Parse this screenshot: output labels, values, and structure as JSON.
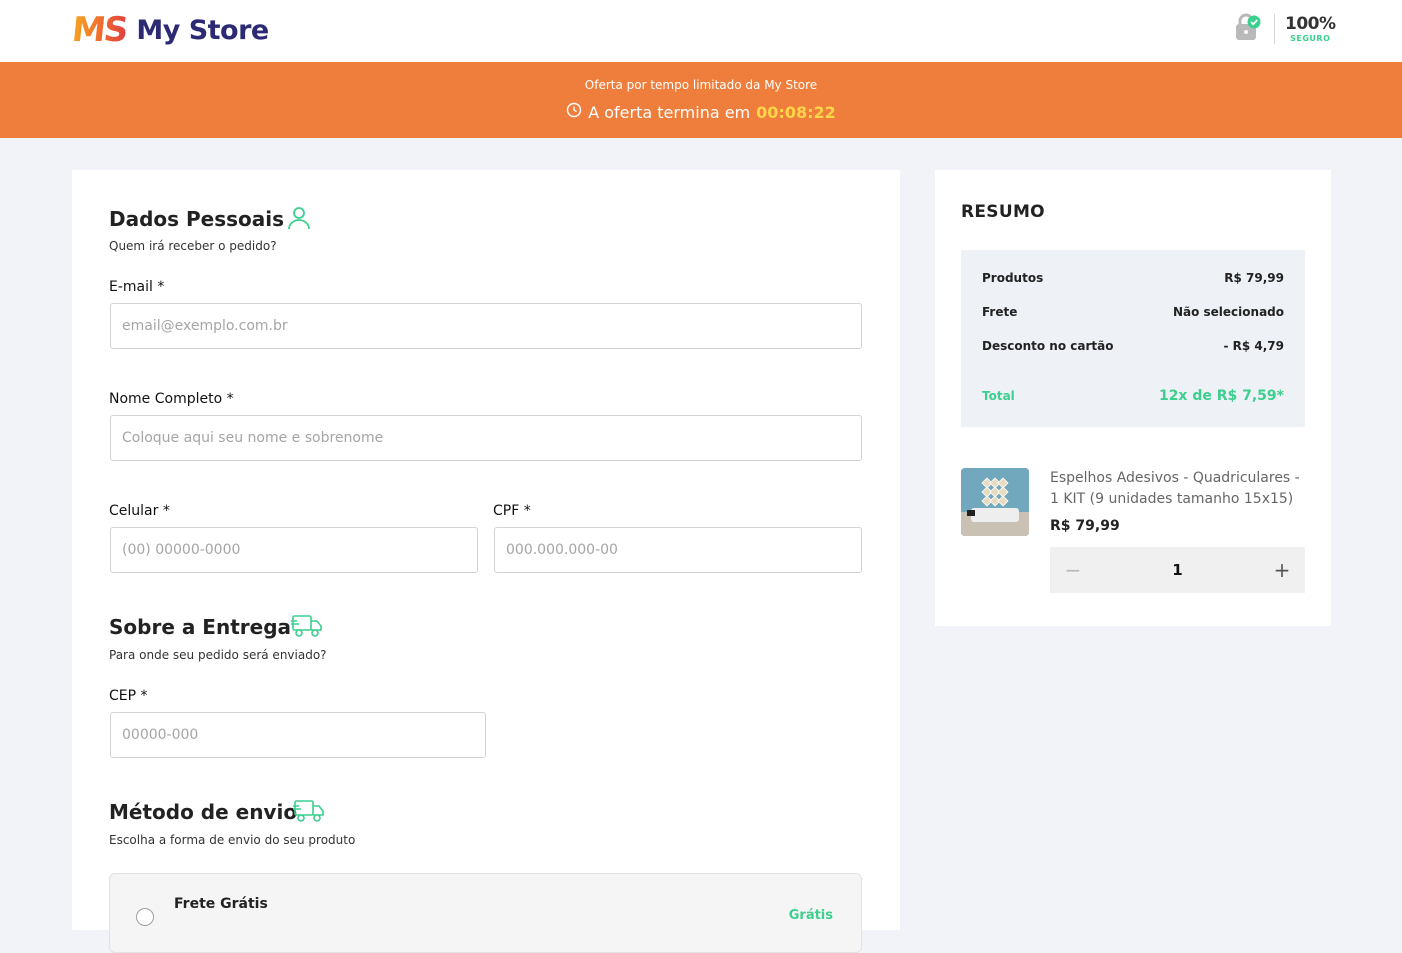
{
  "header": {
    "logo_mark": "MS",
    "store_name": "My Store",
    "secure_percent": "100%",
    "secure_label": "SEGURO",
    "secure_icon": "lock-check-icon"
  },
  "banner": {
    "title": "Oferta por tempo limitado da My Store",
    "ends_label": "A oferta termina em",
    "countdown": "00:08:22",
    "clock_icon": "clock-icon"
  },
  "personal": {
    "title": "Dados Pessoais",
    "subtitle": "Quem irá receber o pedido?",
    "icon": "user-icon",
    "email_label": "E-mail *",
    "email_placeholder": "email@exemplo.com.br",
    "email_value": "",
    "name_label": "Nome Completo *",
    "name_placeholder": "Coloque aqui seu nome e sobrenome",
    "name_value": "",
    "phone_label": "Celular *",
    "phone_placeholder": "(00) 00000-0000",
    "phone_value": "",
    "cpf_label": "CPF *",
    "cpf_placeholder": "000.000.000-00",
    "cpf_value": ""
  },
  "delivery": {
    "title": "Sobre a Entrega",
    "subtitle": "Para onde seu pedido será enviado?",
    "icon": "truck-icon",
    "cep_label": "CEP *",
    "cep_placeholder": "00000-000",
    "cep_value": ""
  },
  "shipping": {
    "title": "Método de envio",
    "subtitle": "Escolha a forma de envio do seu produto",
    "icon": "truck-icon",
    "options": [
      {
        "name": "Frete Grátis",
        "price": "Grátis",
        "selected": false
      }
    ]
  },
  "summary": {
    "title": "RESUMO",
    "rows": [
      {
        "label": "Produtos",
        "value": "R$ 79,99"
      },
      {
        "label": "Frete",
        "value": "Não selecionado"
      },
      {
        "label": "Desconto no cartão",
        "value": "- R$ 4,79"
      }
    ],
    "total_label": "Total",
    "total_value": "12x de R$ 7,59*",
    "accent_color": "#3ccf8e"
  },
  "product": {
    "name": "Espelhos Adesivos - Quadriculares - 1 KIT (9 unidades tamanho 15x15)",
    "price": "R$ 79,99",
    "quantity": "1",
    "minus": "−",
    "plus": "+"
  },
  "colors": {
    "banner": "#ef7e3c",
    "countdown": "#ffd54a",
    "brand_navy": "#2b2a73",
    "accent_green": "#3ccf8e"
  }
}
